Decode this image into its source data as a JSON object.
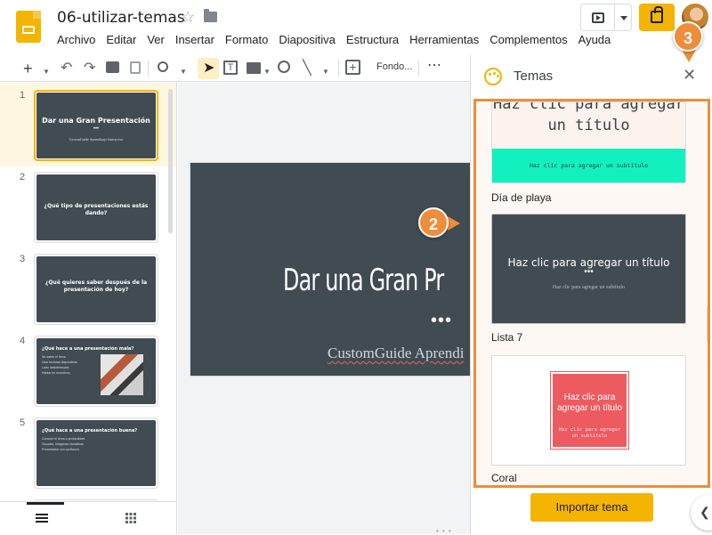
{
  "app": {
    "doc_title": "06-utilizar-temas",
    "menu": [
      "Archivo",
      "Editar",
      "Ver",
      "Insertar",
      "Formato",
      "Diapositiva",
      "Estructura",
      "Herramientas",
      "Complementos",
      "Ayuda"
    ]
  },
  "toolbar": {
    "fondo_label": "Fondo...",
    "more_label": "⋯"
  },
  "slides": [
    {
      "num": "1",
      "title": "Dar una Gran Presentación",
      "subtitle": "CustomGuide Aprendizaje Interactivo"
    },
    {
      "num": "2",
      "title": "¿Qué tipo de presentaciones estás dando?"
    },
    {
      "num": "3",
      "title": "¿Qué quieres saber después de la presentación de hoy?"
    },
    {
      "num": "4",
      "title": "¿Qué hace a una presentación mala?",
      "bullets": [
        "No saber el tema",
        "Usar lecturas diapositivas",
        "Lado desinteresado",
        "Hablar en monótono"
      ]
    },
    {
      "num": "5",
      "title": "¿Qué hace a una presentación buena?",
      "bullets": [
        "Conocer el tema a profundidad",
        "Visuales, imágenes llamativas",
        "Presentador con confianza"
      ]
    }
  ],
  "main_slide": {
    "title": "Dar una Gran Pr",
    "dots": "•••",
    "subtitle": "CustomGuide Aprendi"
  },
  "themes_panel": {
    "title": "Temas",
    "close": "✕",
    "themes": [
      {
        "name": "Día de playa",
        "title_text": "Haz clic para agregar un título",
        "subtitle_text": "Haz clic para agregar un subtítulo"
      },
      {
        "name": "Lista 7",
        "title_text": "Haz clic para agregar un título",
        "dots": "•••",
        "subtitle_text": "Haz clic para agregar un subtítulo"
      },
      {
        "name": "Coral",
        "title_text": "Haz clic para agregar un título",
        "subtitle_text": "Haz clic para agregar un subtítulo"
      }
    ],
    "import_label": "Importar tema"
  },
  "callouts": {
    "two": "2",
    "three": "3"
  },
  "colors": {
    "accent": "#f4b400",
    "callout": "#ef8d3a",
    "slide_bg": "#404b52",
    "beach_band": "#12f0c0",
    "coral": "#ed5b61"
  }
}
